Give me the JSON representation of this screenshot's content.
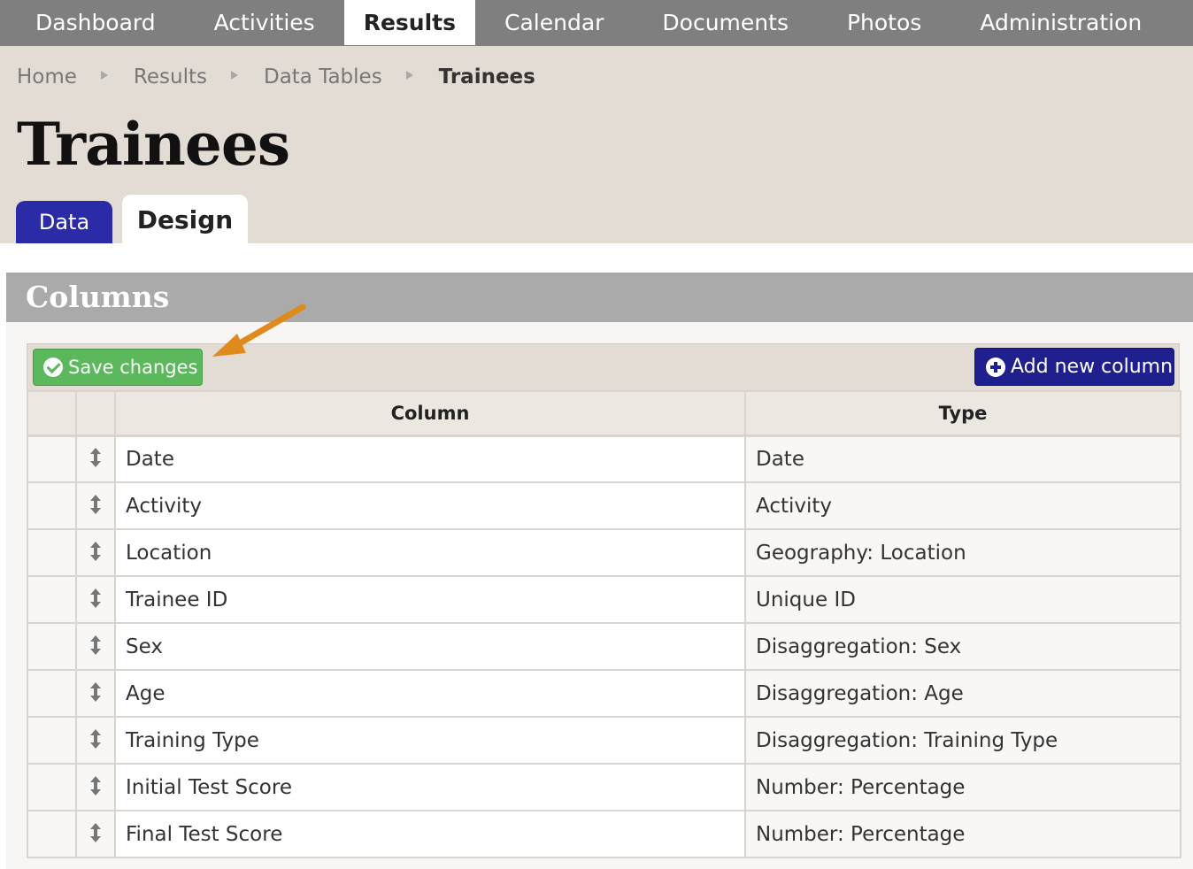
{
  "nav": {
    "items": [
      {
        "label": "Dashboard",
        "active": false
      },
      {
        "label": "Activities",
        "active": false
      },
      {
        "label": "Results",
        "active": true
      },
      {
        "label": "Calendar",
        "active": false
      },
      {
        "label": "Documents",
        "active": false
      },
      {
        "label": "Photos",
        "active": false
      },
      {
        "label": "Administration",
        "active": false
      }
    ]
  },
  "breadcrumb": [
    "Home",
    "Results",
    "Data Tables",
    "Trainees"
  ],
  "page": {
    "title": "Trainees"
  },
  "tabs": [
    {
      "label": "Data",
      "active": false
    },
    {
      "label": "Design",
      "active": true
    }
  ],
  "columns_panel": {
    "title": "Columns",
    "save_label": "Save changes",
    "add_label": "Add new column",
    "headers": {
      "column": "Column",
      "type": "Type"
    },
    "rows": [
      {
        "name": "Date",
        "type": "Date"
      },
      {
        "name": "Activity",
        "type": "Activity"
      },
      {
        "name": "Location",
        "type": "Geography: Location"
      },
      {
        "name": "Trainee ID",
        "type": "Unique ID"
      },
      {
        "name": "Sex",
        "type": "Disaggregation: Sex"
      },
      {
        "name": "Age",
        "type": "Disaggregation: Age"
      },
      {
        "name": "Training Type",
        "type": "Disaggregation: Training Type"
      },
      {
        "name": "Initial Test Score",
        "type": "Number: Percentage"
      },
      {
        "name": "Final Test Score",
        "type": "Number: Percentage"
      }
    ]
  },
  "colors": {
    "nav_bg": "#7f7f7f",
    "header_bg": "#e3dcd5",
    "tab_active_bg": "#2b2ba8",
    "save_button": "#5cb85c",
    "add_button": "#1f1f8e",
    "annotation_arrow": "#e08a1e"
  },
  "icons": {
    "save": "check-circle-icon",
    "add": "plus-circle-icon",
    "row_handle": "drag-handle-icon",
    "annotation": "pointer-arrow-icon"
  }
}
